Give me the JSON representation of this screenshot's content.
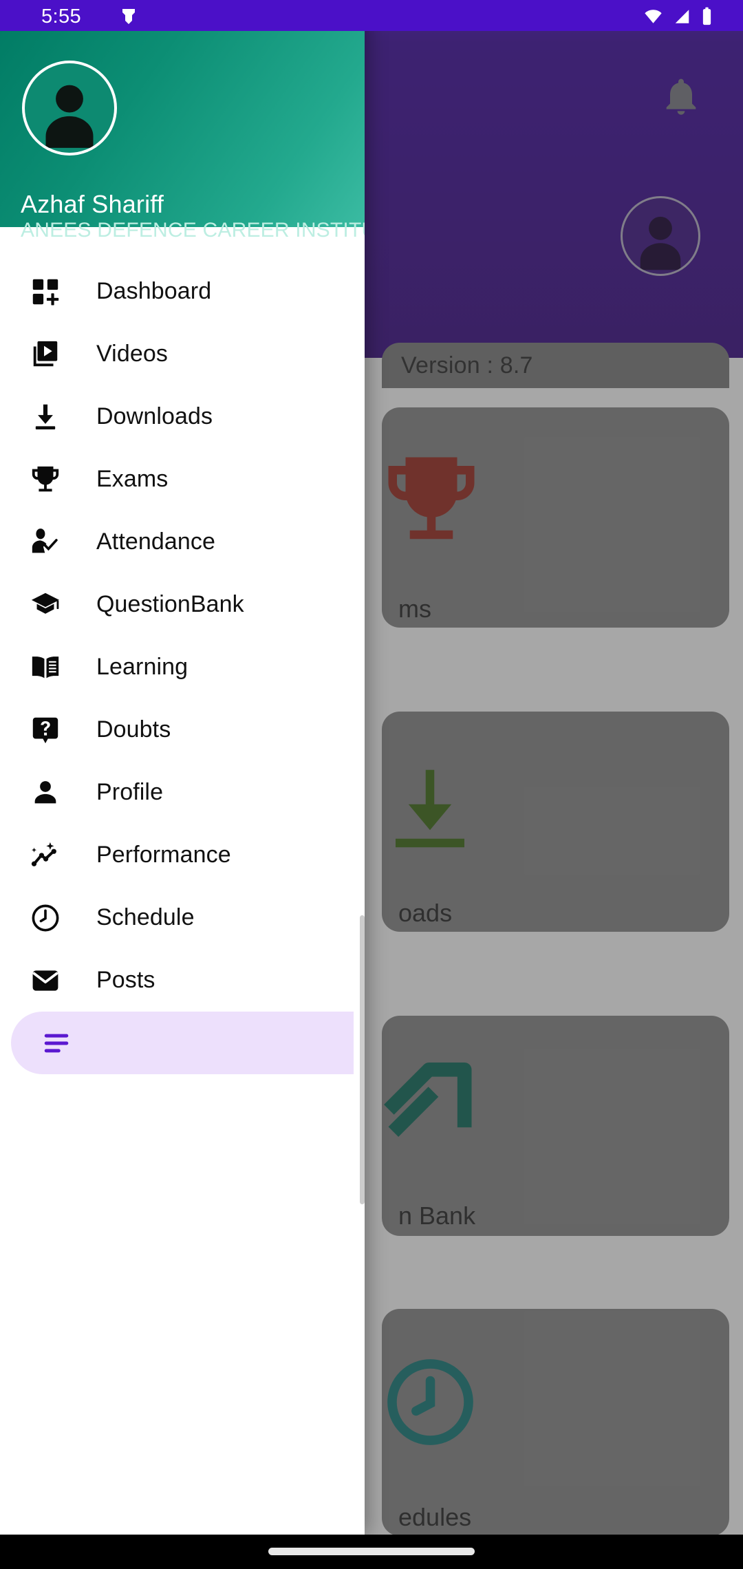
{
  "status_bar": {
    "time": "5:55",
    "icons": [
      "notification-dot-icon",
      "wifi-icon",
      "cellular-signal-icon",
      "battery-icon"
    ],
    "background_color": "#4B10C8"
  },
  "drawer": {
    "header": {
      "user_name": "Azhaf Shariff",
      "organization": "ANEES DEFENCE CAREER INSTITUTE",
      "avatar_icon": "person-avatar-icon",
      "gradient_from": "#007a63",
      "gradient_to": "#3bbba2"
    },
    "items": [
      {
        "label": "Dashboard",
        "icon": "dashboard-grid-plus-icon",
        "selected": false
      },
      {
        "label": "Videos",
        "icon": "video-library-icon",
        "selected": false
      },
      {
        "label": "Downloads",
        "icon": "download-arrow-icon",
        "selected": false
      },
      {
        "label": "Exams",
        "icon": "trophy-icon",
        "selected": false
      },
      {
        "label": "Attendance",
        "icon": "person-check-icon",
        "selected": false
      },
      {
        "label": "QuestionBank",
        "icon": "graduation-cap-icon",
        "selected": false
      },
      {
        "label": "Learning",
        "icon": "open-book-icon",
        "selected": false
      },
      {
        "label": "Doubts",
        "icon": "question-bubble-icon",
        "selected": false
      },
      {
        "label": "Profile",
        "icon": "person-icon",
        "selected": false
      },
      {
        "label": "Performance",
        "icon": "trend-sparkle-icon",
        "selected": false
      },
      {
        "label": "Schedule",
        "icon": "clock-icon",
        "selected": false
      },
      {
        "label": "Posts",
        "icon": "envelope-icon",
        "selected": false
      },
      {
        "label": "",
        "icon": "menu-list-icon",
        "selected": true
      }
    ],
    "selected_accent_color": "#5B18D0",
    "selected_background_color": "#EDE0FC"
  },
  "background_app": {
    "header_color": "#3F0E9E",
    "bell_icon": "notification-bell-icon",
    "avatar_icon": "person-avatar-icon",
    "version_label": "Version : 8.7",
    "cards": [
      {
        "label": "ms",
        "full_label": "Exams",
        "icon": "trophy-icon",
        "icon_color": "#9c2b20"
      },
      {
        "label": "oads",
        "full_label": "Downloads",
        "icon": "download-icon",
        "icon_color": "#3d6b14"
      },
      {
        "label": "n Bank",
        "full_label": "Question Bank",
        "icon": "question-bank-icon",
        "icon_color": "#0d6b59"
      },
      {
        "label": "edules",
        "full_label": "Schedules",
        "icon": "clock-icon",
        "icon_color": "#147a78"
      }
    ]
  },
  "nav_bar": {
    "gesture_pill": "home-gesture-pill"
  }
}
